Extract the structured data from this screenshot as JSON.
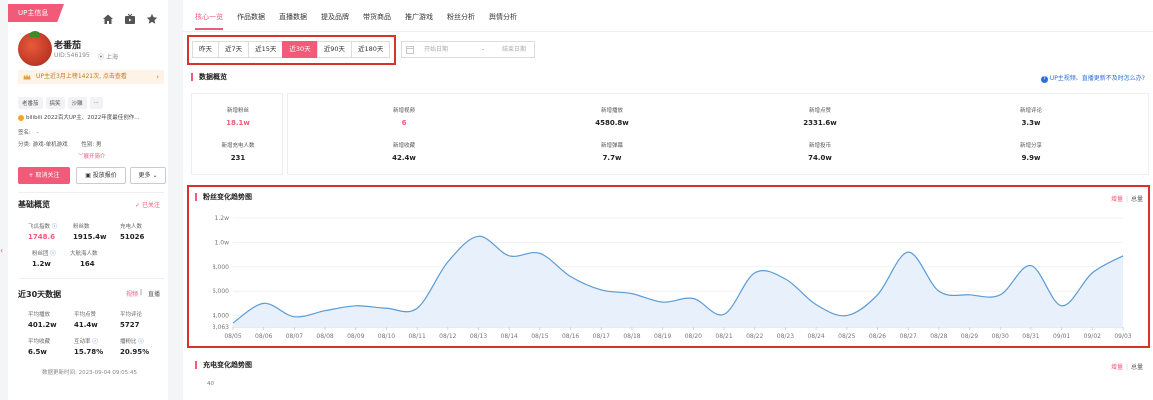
{
  "up_tag": "UP主信息",
  "profile": {
    "name": "老番茄",
    "uid": "UID:546195",
    "location": "上海",
    "notice": "UP主近3月上榜1421次, 点击查看",
    "tags": [
      "老番茄",
      "搞笑",
      "沙雕",
      "..."
    ],
    "bio": "bilibili 2022百大UP主、2022年度最佳创作...",
    "signature_label": "签名:",
    "signature_value": "-",
    "category_label": "分类:",
    "category_value": "游戏-单机游戏",
    "gender_label": "性别:",
    "gender_value": "男",
    "expand": "展开简介",
    "follow_btn": "取消关注",
    "invest_btn": "投放报价",
    "more_btn": "更多"
  },
  "basic": {
    "title": "基础概览",
    "followed": "已关注",
    "stats": [
      {
        "label": "飞瓜指数",
        "value": "1748.6"
      },
      {
        "label": "粉丝数",
        "value": "1915.4w"
      },
      {
        "label": "充电人数",
        "value": "51026"
      },
      {
        "label": "粉丝团",
        "value": "1.2w"
      },
      {
        "label": "大航海人数",
        "value": "164"
      }
    ]
  },
  "last30": {
    "title": "近30天数据",
    "opt_video": "视频",
    "opt_live": "直播",
    "stats": [
      {
        "label": "平均播放",
        "value": "401.2w"
      },
      {
        "label": "平均点赞",
        "value": "41.4w"
      },
      {
        "label": "平均评论",
        "value": "5727"
      },
      {
        "label": "平均收藏",
        "value": "6.5w"
      },
      {
        "label": "互动率",
        "value": "15.78%"
      },
      {
        "label": "播粉比",
        "value": "20.95%"
      }
    ],
    "update_time": "数据更新时间: 2023-09-04 09:05:45"
  },
  "tabs": [
    "核心一览",
    "作品数据",
    "直播数据",
    "提及品牌",
    "带货商品",
    "推广游戏",
    "粉丝分析",
    "舆情分析"
  ],
  "ranges": [
    "昨天",
    "近7天",
    "近15天",
    "近30天",
    "近90天",
    "近180天"
  ],
  "active_range": "近30天",
  "date_start_placeholder": "开始日期",
  "date_sep": "-",
  "date_end_placeholder": "结束日期",
  "overview": {
    "title": "数据概览",
    "help": "UP主视频、直播更新不及时怎么办?",
    "items": [
      {
        "label": "新增粉丝",
        "value": "18.1w"
      },
      {
        "label": "新增充电人数",
        "value": "231"
      },
      {
        "label": "新增视频",
        "value": "6"
      },
      {
        "label": "新增收藏",
        "value": "42.4w"
      },
      {
        "label": "新增播放",
        "value": "4580.8w"
      },
      {
        "label": "新增弹幕",
        "value": "7.7w"
      },
      {
        "label": "新增点赞",
        "value": "2331.6w"
      },
      {
        "label": "新增投币",
        "value": "74.0w"
      },
      {
        "label": "新增评论",
        "value": "3.3w"
      },
      {
        "label": "新增分享",
        "value": "9.9w"
      }
    ]
  },
  "fan_chart": {
    "title": "粉丝变化趋势图",
    "mode_active": "增量",
    "mode_other": "总量"
  },
  "charge_chart": {
    "title": "充电变化趋势图",
    "mode_active": "增量",
    "mode_other": "总量",
    "first_tick": "40"
  },
  "chart_data": {
    "type": "area",
    "title": "粉丝变化趋势图",
    "categories": [
      "08/05",
      "08/06",
      "08/07",
      "08/08",
      "08/09",
      "08/10",
      "08/11",
      "08/12",
      "08/13",
      "08/14",
      "08/15",
      "08/16",
      "08/17",
      "08/18",
      "08/19",
      "08/20",
      "08/21",
      "08/22",
      "08/23",
      "08/24",
      "08/25",
      "08/26",
      "08/27",
      "08/28",
      "08/29",
      "08/30",
      "08/31",
      "09/01",
      "09/02",
      "09/03"
    ],
    "y_tick_labels": [
      "1.2w",
      "1.0w",
      "8,000",
      "6,000",
      "4,000",
      "3,063"
    ],
    "y_ticks": [
      12000,
      10000,
      8000,
      6000,
      4000,
      3063
    ],
    "ylim": [
      3063,
      12000
    ],
    "values": [
      3400,
      5000,
      3900,
      4400,
      4800,
      4600,
      4600,
      8400,
      10500,
      8900,
      9100,
      7200,
      6100,
      5800,
      5100,
      5400,
      4100,
      7500,
      7000,
      4900,
      4000,
      5700,
      9200,
      6000,
      5700,
      5700,
      8100,
      4800,
      7500,
      8900
    ],
    "grid": true,
    "color": "#5b9bd5"
  }
}
